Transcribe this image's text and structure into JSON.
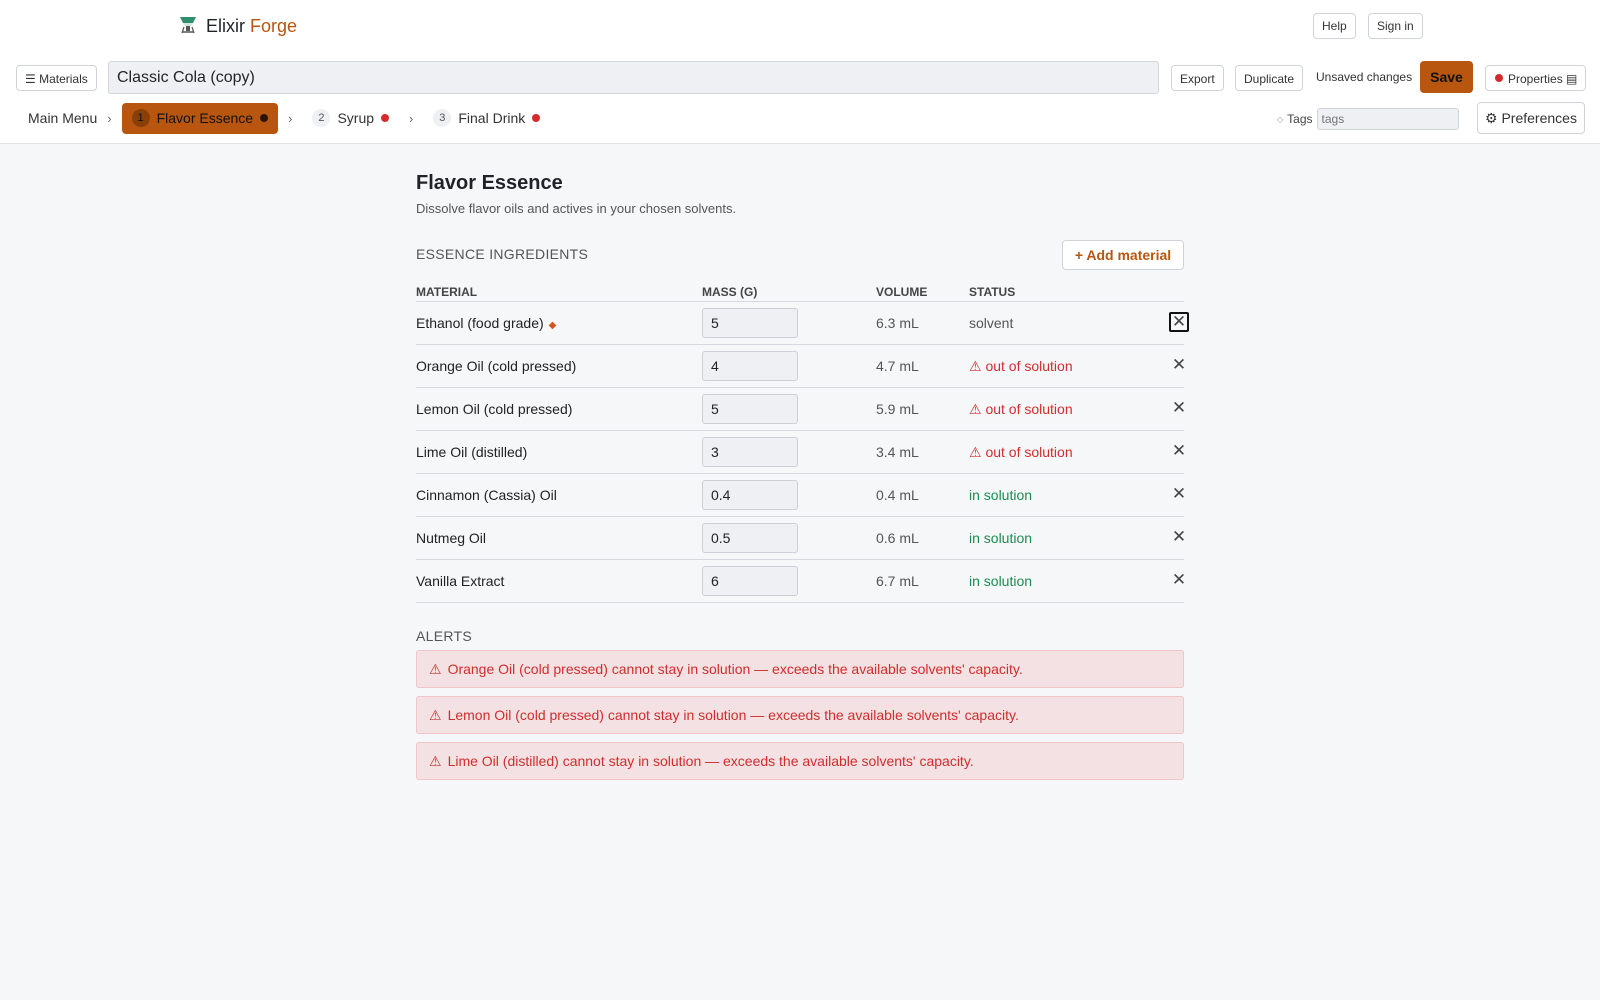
{
  "app": {
    "name_part1": "Elixir",
    "name_part2": "Forge",
    "logo_icon": "flask-icon",
    "accent_color": "#b8560f"
  },
  "topbar": {
    "help_label": "Help",
    "signin_label": "Sign in"
  },
  "toolbar": {
    "materials_label": "☰ Materials",
    "document_title": "Classic Cola (copy)",
    "export_label": "Export",
    "duplicate_label": "Duplicate",
    "unsaved_text": "Unsaved changes",
    "save_label": "Save",
    "properties_label": "Properties ▤"
  },
  "tabs": {
    "main_menu": "Main Menu",
    "separator": "›",
    "items": [
      {
        "number": "1",
        "label": "Flavor Essence",
        "active": true
      },
      {
        "number": "2",
        "label": "Syrup",
        "active": false
      },
      {
        "number": "3",
        "label": "Final Drink",
        "active": false
      }
    ]
  },
  "tags": {
    "label": "Tags",
    "placeholder": "tags"
  },
  "preferences_label": "⚙ Preferences",
  "content": {
    "title": "Flavor Essence",
    "subtitle": "Dissolve flavor oils and actives in your chosen solvents.",
    "section_title": "ESSENCE INGREDIENTS",
    "add_material_label": "+ Add material",
    "columns": {
      "material": "MATERIAL",
      "mass": "MASS (G)",
      "volume": "VOLUME",
      "status": "STATUS"
    },
    "rows": [
      {
        "material": "Ethanol (food grade)",
        "marker": "◆",
        "mass": "5",
        "volume": "6.3 mL",
        "status": "solvent",
        "status_type": "solvent"
      },
      {
        "material": "Orange Oil (cold pressed)",
        "marker": "",
        "mass": "4",
        "volume": "4.7 mL",
        "status": "⚠ out of solution",
        "status_type": "out"
      },
      {
        "material": "Lemon Oil (cold pressed)",
        "marker": "",
        "mass": "5",
        "volume": "5.9 mL",
        "status": "⚠ out of solution",
        "status_type": "out"
      },
      {
        "material": "Lime Oil (distilled)",
        "marker": "",
        "mass": "3",
        "volume": "3.4 mL",
        "status": "⚠ out of solution",
        "status_type": "out"
      },
      {
        "material": "Cinnamon (Cassia) Oil",
        "marker": "",
        "mass": "0.4",
        "volume": "0.4 mL",
        "status": "in solution",
        "status_type": "in"
      },
      {
        "material": "Nutmeg Oil",
        "marker": "",
        "mass": "0.5",
        "volume": "0.6 mL",
        "status": "in solution",
        "status_type": "in"
      },
      {
        "material": "Vanilla Extract",
        "marker": "",
        "mass": "6",
        "volume": "6.7 mL",
        "status": "in solution",
        "status_type": "in"
      }
    ],
    "alerts_title": "ALERTS",
    "alerts": [
      "Orange Oil (cold pressed) cannot stay in solution — exceeds the available solvents' capacity.",
      "Lemon Oil (cold pressed) cannot stay in solution — exceeds the available solvents' capacity.",
      "Lime Oil (distilled) cannot stay in solution — exceeds the available solvents' capacity."
    ],
    "alert_icon": "⚠",
    "remove_glyph": "✕"
  },
  "status_colors": {
    "solvent": "#555555",
    "out": "#d12d2d",
    "in": "#1b8c4f"
  }
}
